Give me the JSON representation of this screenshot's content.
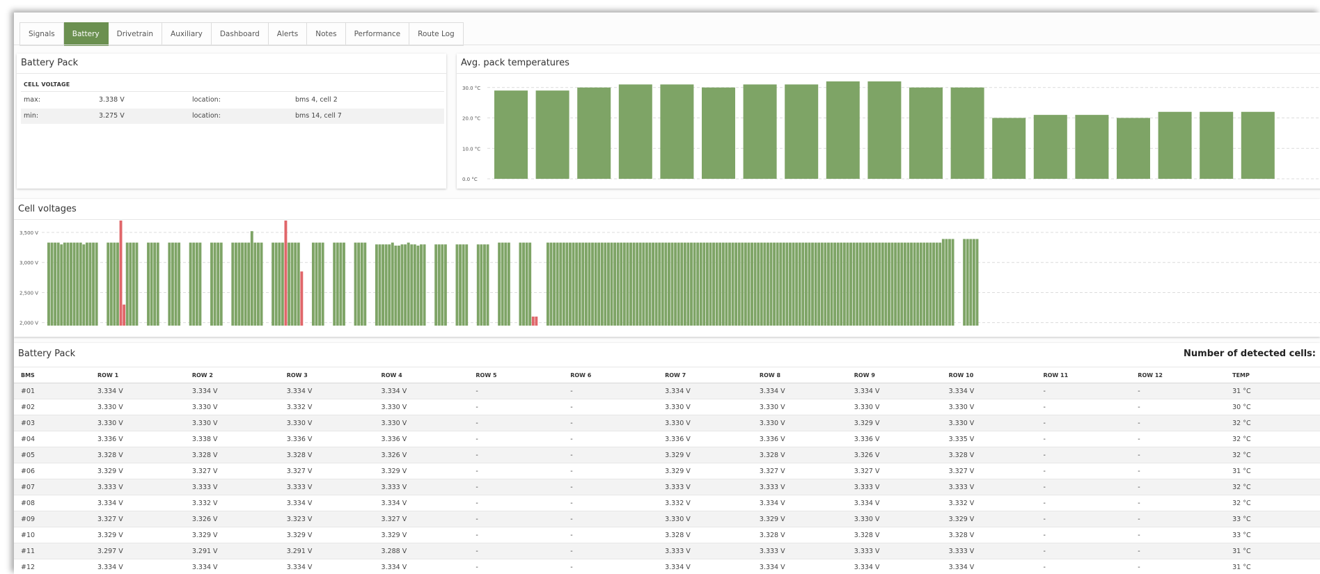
{
  "tabs": [
    "Signals",
    "Battery",
    "Drivetrain",
    "Auxiliary",
    "Dashboard",
    "Alerts",
    "Notes",
    "Performance",
    "Route Log"
  ],
  "active_tab": "Battery",
  "colors": {
    "accent": "#6b9050",
    "bar": "#7ea466",
    "alert": "#e0666a"
  },
  "pack_summary": {
    "title": "Battery Pack",
    "section_label": "CELL VOLTAGE",
    "rows": [
      {
        "key": "max:",
        "value": "3.338 V",
        "loc_label": "location:",
        "loc_value": "bms 4, cell 2"
      },
      {
        "key": "min:",
        "value": "3.275 V",
        "loc_label": "location:",
        "loc_value": "bms 14, cell 7"
      }
    ]
  },
  "temps_chart": {
    "title": "Avg. pack temperatures",
    "chart_data": {
      "type": "bar",
      "y_tick_labels": [
        "30.0 °C",
        "20.0 °C",
        "10.0 °C",
        "0.0 °C"
      ],
      "y_ticks": [
        30,
        20,
        10,
        0
      ],
      "ylim": [
        0,
        32
      ],
      "values": [
        29,
        29,
        30,
        31,
        31,
        30,
        31,
        31,
        32,
        32,
        30,
        30,
        20,
        21,
        21,
        20,
        22,
        22,
        22
      ],
      "grid": true
    }
  },
  "cell_chart": {
    "title": "Cell voltages",
    "chart_data": {
      "type": "bar",
      "y_tick_labels": [
        "3,500 V",
        "3,000 V",
        "2,500 V",
        "2,000 V"
      ],
      "y_ticks": [
        3.5,
        3.0,
        2.5,
        2.0
      ],
      "ylim": [
        2.0,
        3.65
      ],
      "baseline": 1.95,
      "groups": [
        [
          3.33,
          3.33,
          3.33,
          3.33,
          3.3,
          3.33,
          3.33,
          3.33,
          3.33,
          3.33,
          3.33,
          3.3,
          3.33,
          3.33,
          3.33,
          3.33
        ],
        [
          3.33,
          3.33,
          3.33,
          3.33,
          3.76,
          2.3,
          3.33,
          3.33,
          3.33,
          3.33
        ],
        [
          3.33,
          3.33,
          3.33,
          3.33
        ],
        [
          3.33,
          3.33,
          3.33,
          3.33
        ],
        [
          3.33,
          3.33,
          3.33,
          3.33
        ],
        [
          3.33,
          3.33,
          3.33,
          3.33
        ],
        [
          3.33,
          3.33,
          3.33,
          3.33,
          3.33,
          3.33,
          3.52,
          3.33,
          3.33,
          3.33
        ],
        [
          3.33,
          3.33,
          3.33,
          3.33,
          3.76,
          3.33,
          3.33,
          3.33,
          3.33,
          2.85
        ],
        [
          3.33,
          3.33,
          3.33,
          3.33
        ],
        [
          3.33,
          3.33,
          3.33,
          3.33
        ],
        [
          3.33,
          3.33,
          3.33,
          3.33
        ],
        [
          3.3,
          3.3,
          3.3,
          3.3,
          3.3,
          3.33,
          3.28,
          3.28,
          3.3,
          3.3,
          3.33,
          3.3,
          3.3,
          3.28,
          3.3,
          3.3
        ],
        [
          3.3,
          3.3,
          3.3,
          3.3
        ],
        [
          3.3,
          3.3,
          3.3,
          3.3
        ],
        [
          3.3,
          3.3,
          3.3,
          3.3
        ],
        [
          3.33,
          3.33,
          3.33,
          3.33
        ],
        [
          3.33,
          3.33,
          3.33,
          3.33,
          2.1,
          2.1
        ],
        [
          3.33,
          3.33,
          3.33,
          3.33,
          3.33,
          3.33,
          3.33,
          3.33,
          3.33,
          3.33,
          3.33,
          3.33,
          3.33,
          3.33,
          3.33,
          3.33,
          3.33,
          3.33,
          3.33,
          3.33,
          3.33,
          3.33,
          3.33,
          3.33,
          3.33,
          3.33,
          3.33,
          3.33,
          3.33,
          3.33,
          3.33,
          3.33,
          3.33,
          3.33,
          3.33,
          3.33,
          3.33,
          3.33,
          3.33,
          3.33,
          3.33,
          3.33,
          3.33,
          3.33,
          3.33,
          3.33,
          3.33,
          3.33,
          3.33,
          3.33,
          3.33,
          3.33,
          3.33,
          3.33,
          3.33,
          3.33,
          3.33,
          3.33,
          3.33,
          3.33,
          3.33,
          3.33,
          3.33,
          3.33,
          3.33,
          3.33,
          3.33,
          3.33,
          3.33,
          3.33,
          3.33,
          3.33,
          3.33,
          3.33,
          3.33,
          3.33,
          3.33,
          3.33,
          3.33,
          3.33,
          3.33,
          3.33,
          3.33,
          3.33,
          3.33,
          3.33,
          3.33,
          3.33,
          3.33,
          3.33,
          3.33,
          3.33,
          3.33,
          3.33,
          3.33,
          3.33,
          3.33,
          3.33,
          3.33,
          3.33,
          3.33,
          3.33,
          3.33,
          3.33,
          3.33,
          3.33,
          3.33,
          3.33,
          3.33,
          3.33,
          3.33,
          3.33,
          3.33,
          3.33,
          3.33,
          3.33,
          3.33,
          3.33,
          3.33,
          3.33,
          3.33,
          3.33,
          3.33,
          3.33,
          3.39,
          3.39,
          3.39,
          3.39
        ],
        [
          3.39,
          3.39,
          3.39,
          3.39,
          3.39
        ]
      ],
      "alert_threshold_high": 3.6,
      "alert_threshold_low": 3.0
    }
  },
  "pack_table": {
    "title": "Battery Pack",
    "detected_label": "Number of detected cells:",
    "columns": [
      "BMS",
      "ROW 1",
      "ROW 2",
      "ROW 3",
      "ROW 4",
      "ROW 5",
      "ROW 6",
      "ROW 7",
      "ROW 8",
      "ROW 9",
      "ROW 10",
      "ROW 11",
      "ROW 12",
      "TEMP"
    ],
    "rows": [
      [
        "#01",
        "3.334 V",
        "3.334 V",
        "3.334 V",
        "3.334 V",
        "-",
        "-",
        "3.334 V",
        "3.334 V",
        "3.334 V",
        "3.334 V",
        "-",
        "-",
        "31 °C"
      ],
      [
        "#02",
        "3.330 V",
        "3.330 V",
        "3.332 V",
        "3.330 V",
        "-",
        "-",
        "3.330 V",
        "3.330 V",
        "3.330 V",
        "3.330 V",
        "-",
        "-",
        "30 °C"
      ],
      [
        "#03",
        "3.330 V",
        "3.330 V",
        "3.330 V",
        "3.330 V",
        "-",
        "-",
        "3.330 V",
        "3.330 V",
        "3.329 V",
        "3.330 V",
        "-",
        "-",
        "32 °C"
      ],
      [
        "#04",
        "3.336 V",
        "3.338 V",
        "3.336 V",
        "3.336 V",
        "-",
        "-",
        "3.336 V",
        "3.336 V",
        "3.336 V",
        "3.335 V",
        "-",
        "-",
        "32 °C"
      ],
      [
        "#05",
        "3.328 V",
        "3.328 V",
        "3.328 V",
        "3.326 V",
        "-",
        "-",
        "3.329 V",
        "3.328 V",
        "3.326 V",
        "3.328 V",
        "-",
        "-",
        "32 °C"
      ],
      [
        "#06",
        "3.329 V",
        "3.327 V",
        "3.327 V",
        "3.329 V",
        "-",
        "-",
        "3.329 V",
        "3.327 V",
        "3.327 V",
        "3.327 V",
        "-",
        "-",
        "31 °C"
      ],
      [
        "#07",
        "3.333 V",
        "3.333 V",
        "3.333 V",
        "3.333 V",
        "-",
        "-",
        "3.333 V",
        "3.333 V",
        "3.333 V",
        "3.333 V",
        "-",
        "-",
        "32 °C"
      ],
      [
        "#08",
        "3.334 V",
        "3.332 V",
        "3.334 V",
        "3.334 V",
        "-",
        "-",
        "3.332 V",
        "3.334 V",
        "3.334 V",
        "3.332 V",
        "-",
        "-",
        "32 °C"
      ],
      [
        "#09",
        "3.327 V",
        "3.326 V",
        "3.323 V",
        "3.327 V",
        "-",
        "-",
        "3.330 V",
        "3.329 V",
        "3.330 V",
        "3.329 V",
        "-",
        "-",
        "33 °C"
      ],
      [
        "#10",
        "3.329 V",
        "3.329 V",
        "3.329 V",
        "3.329 V",
        "-",
        "-",
        "3.328 V",
        "3.328 V",
        "3.328 V",
        "3.328 V",
        "-",
        "-",
        "33 °C"
      ],
      [
        "#11",
        "3.297 V",
        "3.291 V",
        "3.291 V",
        "3.288 V",
        "-",
        "-",
        "3.333 V",
        "3.333 V",
        "3.333 V",
        "3.333 V",
        "-",
        "-",
        "31 °C"
      ],
      [
        "#12",
        "3.334 V",
        "3.334 V",
        "3.334 V",
        "3.334 V",
        "-",
        "-",
        "3.334 V",
        "3.334 V",
        "3.334 V",
        "3.334 V",
        "-",
        "-",
        "31 °C"
      ]
    ]
  }
}
